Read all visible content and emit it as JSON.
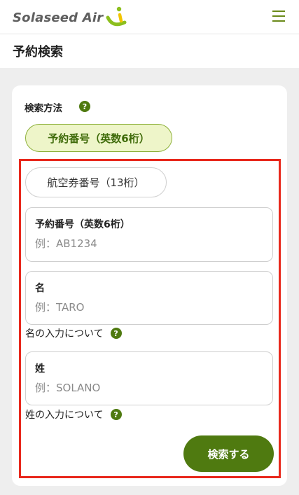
{
  "header": {
    "logo_text": "Solaseed Air",
    "menu_icon": "hamburger-menu-icon"
  },
  "page": {
    "title": "予約検索"
  },
  "search_method": {
    "label": "検索方法",
    "help_icon_text": "?",
    "selected_option": "予約番号（英数6桁）",
    "other_option": "航空券番号（13桁）"
  },
  "form": {
    "reservation_number": {
      "label": "予約番号（英数6桁）",
      "value": "",
      "placeholder": "例：AB1234"
    },
    "first_name": {
      "label": "名",
      "value": "",
      "placeholder": "例：TARO",
      "note": "名の入力について"
    },
    "last_name": {
      "label": "姓",
      "value": "",
      "placeholder": "例：SOLANO",
      "note": "姓の入力について"
    },
    "submit_label": "検索する"
  },
  "colors": {
    "brand_green": "#4f7a10",
    "logo_yellow": "#f2c500",
    "selected_chip_bg": "#eef5c9",
    "highlight_red": "#e8281c"
  }
}
